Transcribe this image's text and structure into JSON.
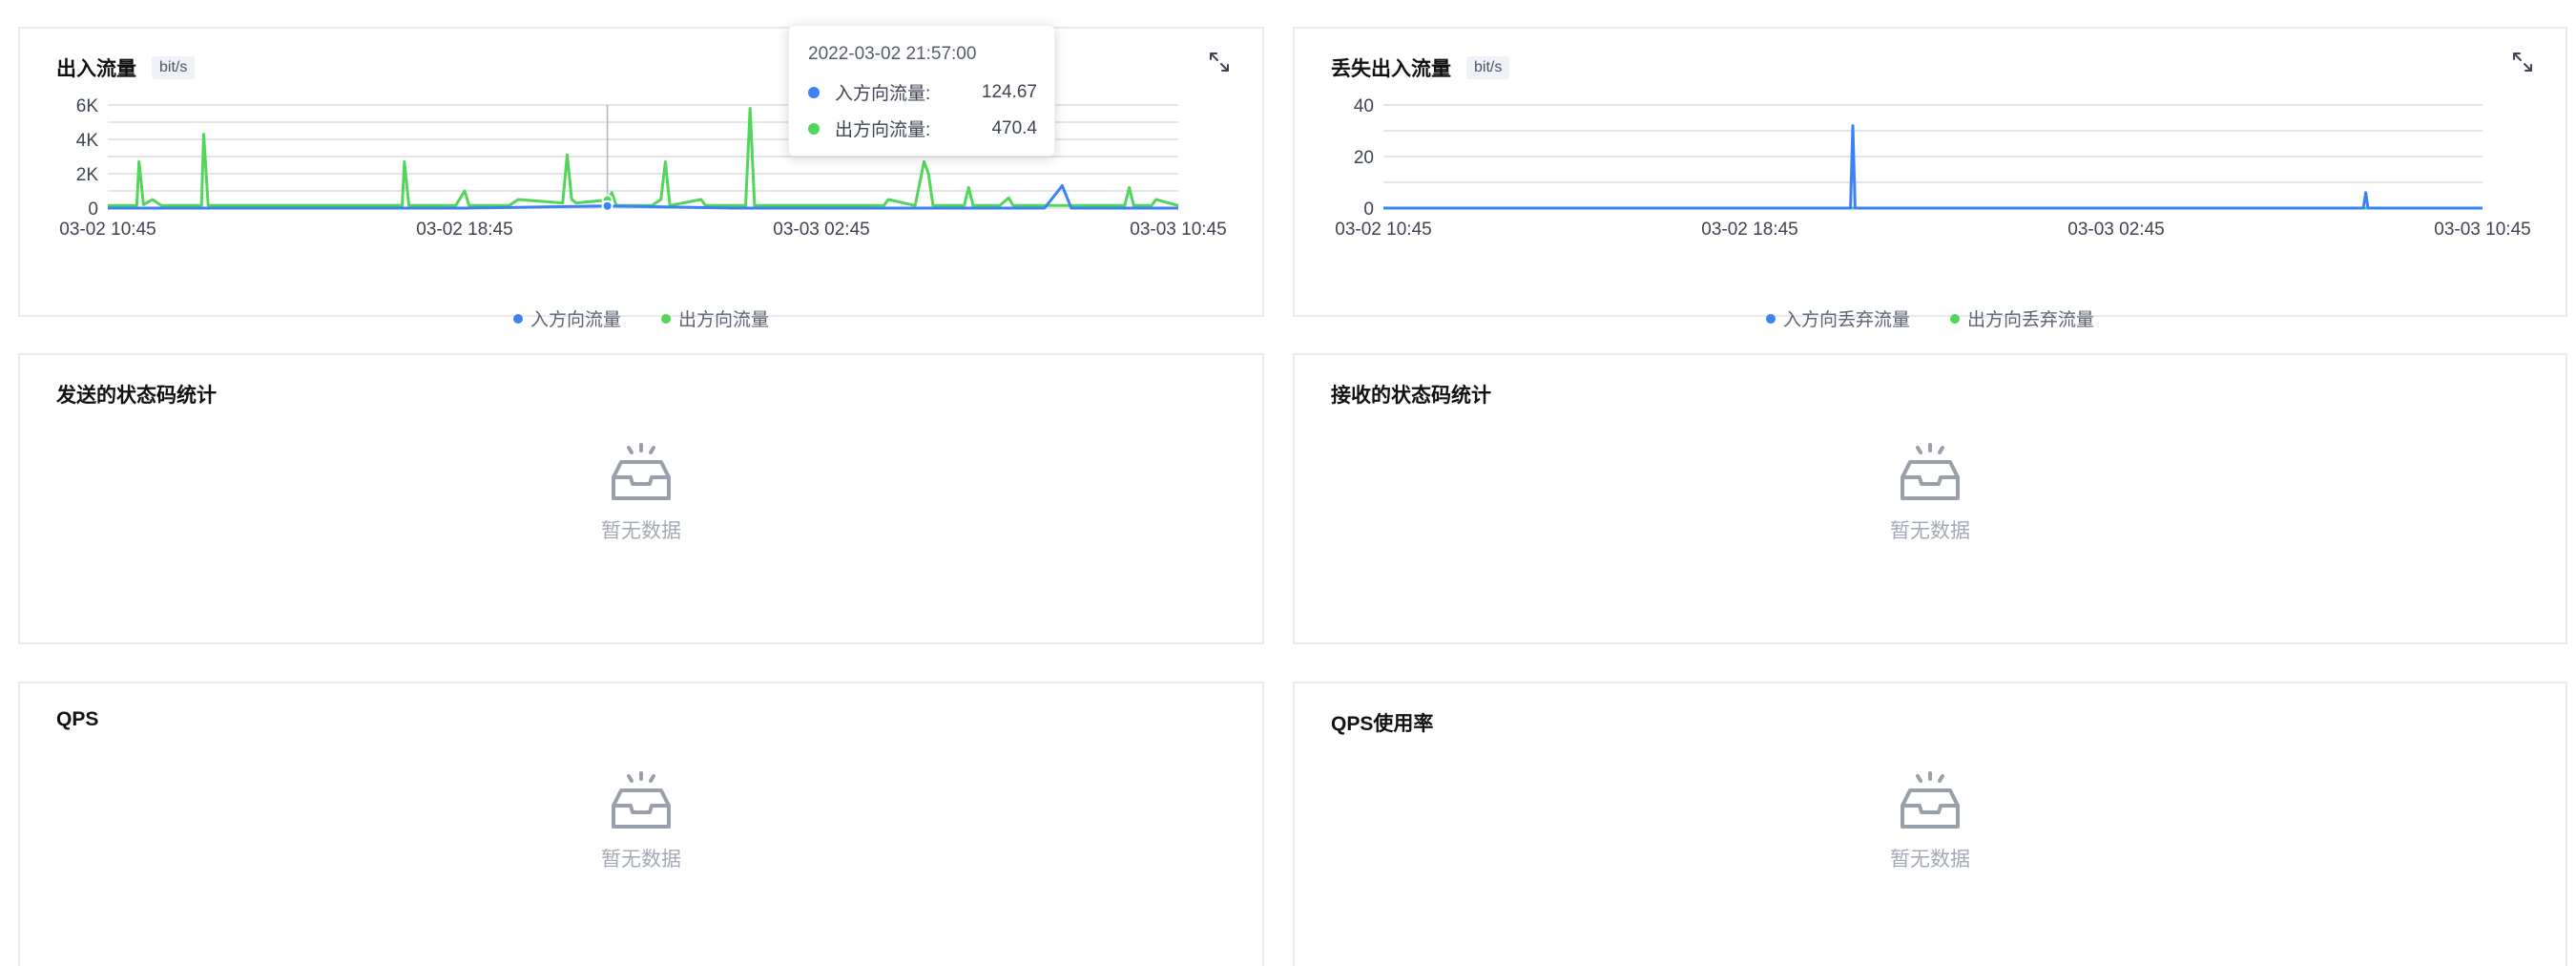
{
  "colors": {
    "inbound": "#3b82f6",
    "outbound": "#52d65a",
    "grid": "#d8dbe0",
    "empty_icon": "#9aa0ab"
  },
  "panels": {
    "traffic": {
      "title": "出入流量",
      "unit": "bit/s",
      "legend": [
        "入方向流量",
        "出方向流量"
      ],
      "tooltip": {
        "time": "2022-03-02 21:57:00",
        "rows": [
          {
            "label": "入方向流量:",
            "value": "124.67"
          },
          {
            "label": "出方向流量:",
            "value": "470.4"
          }
        ]
      }
    },
    "dropped": {
      "title": "丢失出入流量",
      "unit": "bit/s",
      "legend": [
        "入方向丢弃流量",
        "出方向丢弃流量"
      ]
    },
    "sent_status": {
      "title": "发送的状态码统计",
      "empty": "暂无数据"
    },
    "recv_status": {
      "title": "接收的状态码统计",
      "empty": "暂无数据"
    },
    "qps": {
      "title": "QPS",
      "empty": "暂无数据"
    },
    "qps_usage": {
      "title": "QPS使用率",
      "empty": "暂无数据"
    }
  },
  "chart_data": [
    {
      "type": "line",
      "title": "出入流量",
      "ylabel": "bit/s",
      "x_ticks": [
        "03-02 10:45",
        "03-02 18:45",
        "03-03 02:45",
        "03-03 10:45"
      ],
      "y_ticks": [
        "0",
        "2K",
        "4K",
        "6K"
      ],
      "ylim": [
        0,
        6000
      ],
      "x_range_hours": [
        0,
        24
      ],
      "grid": true,
      "legend": "bottom",
      "series": [
        {
          "name": "入方向流量",
          "points": [
            [
              0,
              0
            ],
            [
              4,
              0
            ],
            [
              8,
              0
            ],
            [
              11.2,
              125
            ],
            [
              14,
              0
            ],
            [
              18,
              0
            ],
            [
              21,
              0
            ],
            [
              21.4,
              1300
            ],
            [
              21.6,
              0
            ],
            [
              22.8,
              0
            ],
            [
              24,
              0
            ]
          ]
        },
        {
          "name": "出方向流量",
          "points": [
            [
              0,
              150
            ],
            [
              0.65,
              150
            ],
            [
              0.7,
              2700
            ],
            [
              0.8,
              200
            ],
            [
              1.0,
              500
            ],
            [
              1.2,
              150
            ],
            [
              2.1,
              150
            ],
            [
              2.15,
              4300
            ],
            [
              2.25,
              150
            ],
            [
              3.5,
              150
            ],
            [
              6.6,
              150
            ],
            [
              6.65,
              2700
            ],
            [
              6.75,
              150
            ],
            [
              7.8,
              150
            ],
            [
              8.0,
              1000
            ],
            [
              8.1,
              150
            ],
            [
              9.0,
              150
            ],
            [
              9.2,
              500
            ],
            [
              10.2,
              300
            ],
            [
              10.3,
              3100
            ],
            [
              10.4,
              500
            ],
            [
              10.5,
              300
            ],
            [
              11.2,
              470
            ],
            [
              11.3,
              900
            ],
            [
              11.4,
              150
            ],
            [
              12.2,
              150
            ],
            [
              12.4,
              500
            ],
            [
              12.5,
              2700
            ],
            [
              12.6,
              150
            ],
            [
              13.3,
              500
            ],
            [
              13.4,
              150
            ],
            [
              14.3,
              150
            ],
            [
              14.4,
              5800
            ],
            [
              14.5,
              150
            ],
            [
              15.5,
              150
            ],
            [
              17.4,
              150
            ],
            [
              17.5,
              500
            ],
            [
              18.1,
              150
            ],
            [
              18.3,
              2700
            ],
            [
              18.4,
              2000
            ],
            [
              18.5,
              150
            ],
            [
              19.2,
              150
            ],
            [
              19.3,
              1200
            ],
            [
              19.4,
              150
            ],
            [
              20.0,
              150
            ],
            [
              20.2,
              600
            ],
            [
              20.3,
              150
            ],
            [
              22.8,
              150
            ],
            [
              22.9,
              1200
            ],
            [
              23.0,
              150
            ],
            [
              23.4,
              150
            ],
            [
              23.5,
              500
            ],
            [
              24,
              150
            ]
          ]
        }
      ]
    },
    {
      "type": "line",
      "title": "丢失出入流量",
      "ylabel": "bit/s",
      "x_ticks": [
        "03-02 10:45",
        "03-02 18:45",
        "03-03 02:45",
        "03-03 10:45"
      ],
      "y_ticks": [
        "0",
        "20",
        "40"
      ],
      "ylim": [
        0,
        40
      ],
      "x_range_hours": [
        0,
        24
      ],
      "grid": true,
      "legend": "bottom",
      "series": [
        {
          "name": "入方向丢弃流量",
          "points": [
            [
              0,
              0
            ],
            [
              10.2,
              0
            ],
            [
              10.25,
              32
            ],
            [
              10.3,
              0
            ],
            [
              21.4,
              0
            ],
            [
              21.45,
              6
            ],
            [
              21.5,
              0
            ],
            [
              24,
              0
            ]
          ]
        },
        {
          "name": "出方向丢弃流量",
          "points": [
            [
              0,
              0
            ],
            [
              24,
              0
            ]
          ]
        }
      ]
    }
  ]
}
